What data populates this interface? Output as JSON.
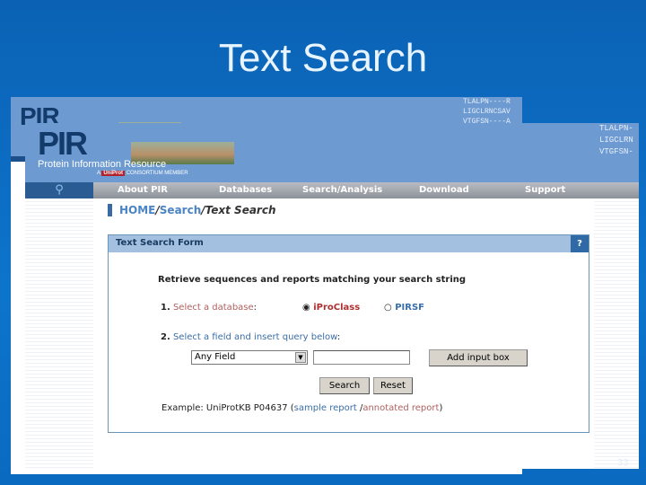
{
  "slide": {
    "title": "Text Search",
    "page_number": "33"
  },
  "header": {
    "logo": "PIR",
    "subtitle": "Protein Information Resource",
    "consortium_prefix": "A",
    "consortium_badge": "UniProt",
    "consortium_suffix": "CONSORTIUM MEMBER",
    "sequence_lines": [
      "TLALPN----R",
      "LIGCLRNCSAV",
      "VTGFSN----A"
    ],
    "sequence_lines_front": [
      "TLALPN-",
      "LIGCLRN",
      "VTGFSN-"
    ]
  },
  "nav": {
    "items": [
      "About PIR",
      "Databases",
      "Search/Analysis",
      "Download",
      "Support"
    ]
  },
  "breadcrumb": {
    "home": "HOME",
    "sep": "/",
    "search": "Search",
    "current": "Text Search"
  },
  "form": {
    "title": "Text Search Form",
    "help": "?",
    "intro": "Retrieve sequences and reports matching your search string",
    "step1_num": "1.",
    "step1_link": "Select a database",
    "colon": ":",
    "db_options": [
      {
        "label": "iProClass",
        "selected": true
      },
      {
        "label": "PIRSF",
        "selected": false
      }
    ],
    "step2_num": "2.",
    "step2_link": "Select a field and insert query below",
    "field_select": "Any Field",
    "query_value": "",
    "add_input": "Add input box",
    "search": "Search",
    "reset": "Reset",
    "example_prefix": "Example: UniProtKB P04637 (",
    "sample_report": "sample report ",
    "slash": "/",
    "annotated_report": "annotated report",
    "example_suffix": ")"
  }
}
